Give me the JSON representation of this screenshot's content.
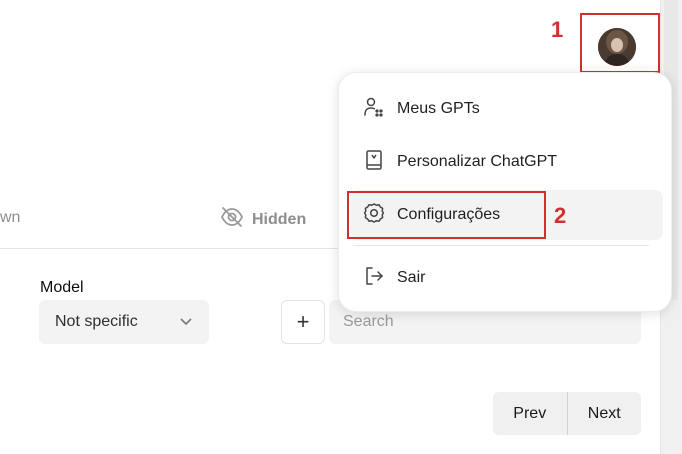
{
  "background": {
    "filter_left_partial": "wn",
    "hidden_filter_label": "Hidden",
    "model_label": "Model",
    "model_select_value": "Not specific",
    "add_button_label": "+",
    "search_placeholder": "Search",
    "pager": {
      "prev": "Prev",
      "next": "Next"
    }
  },
  "menu": {
    "items": [
      {
        "label": "Meus GPTs",
        "icon": "user-apps-icon"
      },
      {
        "label": "Personalizar ChatGPT",
        "icon": "book-icon"
      },
      {
        "label": "Configurações",
        "icon": "gear-icon"
      },
      {
        "label": "Sair",
        "icon": "logout-icon"
      }
    ]
  },
  "annotations": {
    "step1": "1",
    "step2": "2",
    "highlight_color": "#d32f2f"
  }
}
